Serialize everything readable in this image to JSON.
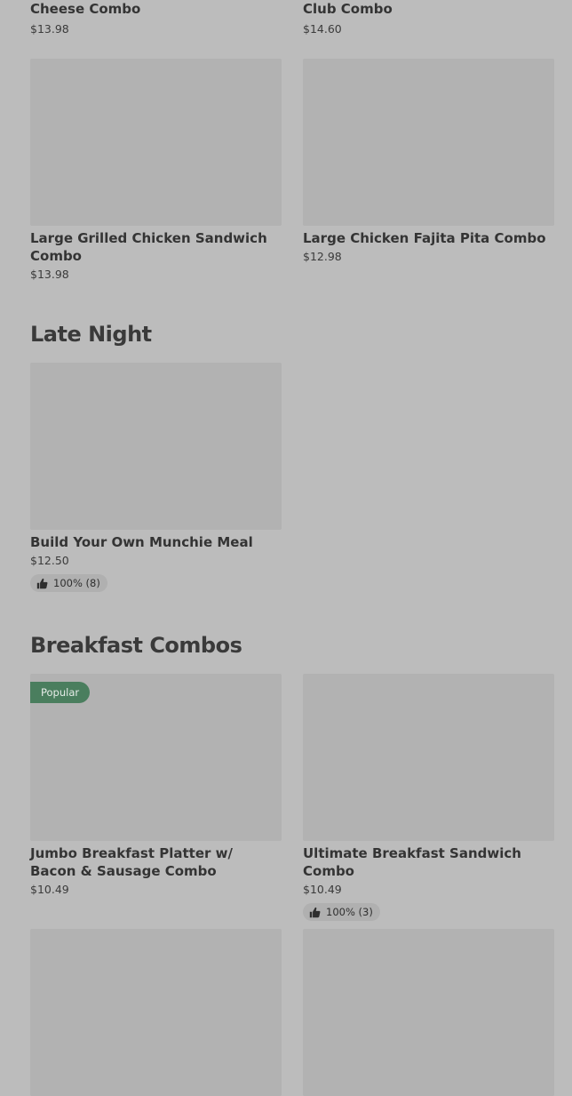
{
  "top_items": [
    {
      "name": "Cheese Combo",
      "price": "$13.98"
    },
    {
      "name": "Club Combo",
      "price": "$14.60"
    }
  ],
  "items_row1": [
    {
      "name": "Large Grilled Chicken Sandwich Combo",
      "price": "$13.98"
    },
    {
      "name": "Large Chicken Fajita Pita Combo",
      "price": "$12.98"
    }
  ],
  "late_night": {
    "title": "Late Night",
    "items": [
      {
        "name": "Build Your Own Munchie Meal",
        "price": "$12.50",
        "rating": "100% (8)"
      }
    ]
  },
  "breakfast": {
    "title": "Breakfast Combos",
    "items": [
      {
        "badge": "Popular",
        "name": "Jumbo Breakfast Platter w/ Bacon & Sausage Combo",
        "price": "$10.49"
      },
      {
        "name": "Ultimate Breakfast Sandwich Combo",
        "price": "$10.49",
        "rating": "100% (3)"
      }
    ]
  },
  "icons": {
    "rating": "thumbs-up-icon"
  },
  "colors": {
    "background": "#bcbcbc",
    "image_placeholder": "#b2b2b2",
    "badge": "#4a7e5e"
  }
}
